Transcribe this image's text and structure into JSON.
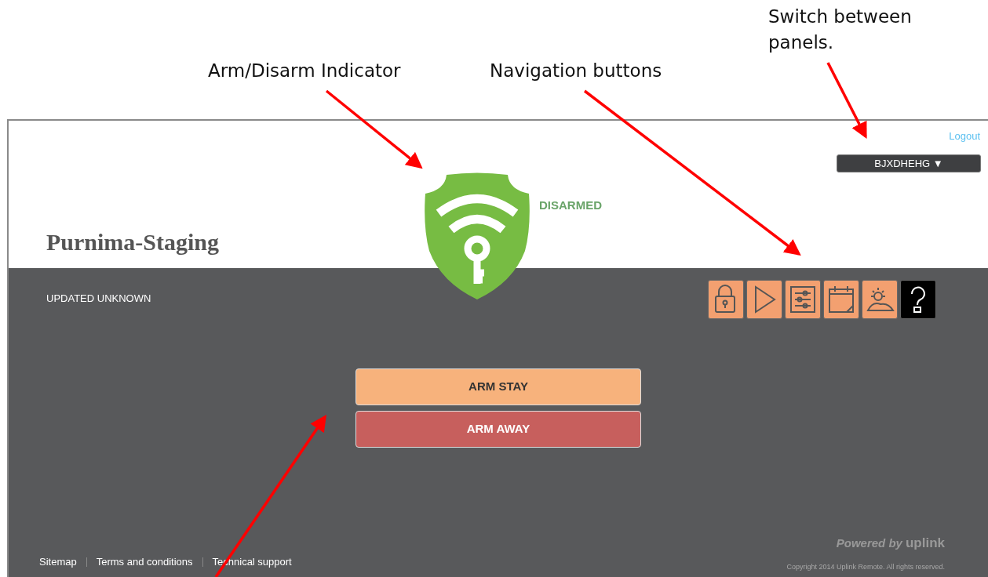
{
  "annotations": [
    {
      "text": "Arm/Disarm Indicator"
    },
    {
      "text": "Navigation buttons"
    },
    {
      "text": "Switch between panels."
    }
  ],
  "header": {
    "logout": "Logout",
    "panel_selector": "BJXDHEHG ▼",
    "site_title": "Purnima-Staging"
  },
  "status": {
    "label": "DISARMED",
    "armed": false
  },
  "updated": "UPDATED UNKNOWN",
  "nav_buttons": [
    {
      "selected": false
    },
    {
      "selected": false
    },
    {
      "selected": false
    },
    {
      "selected": false
    },
    {
      "selected": false
    },
    {
      "selected": true
    }
  ],
  "actions": [
    {
      "label": "ARM STAY",
      "kind": "stay"
    },
    {
      "label": "ARM AWAY",
      "kind": "away"
    }
  ],
  "footer": {
    "links": [
      "Sitemap",
      "Terms and conditions",
      "Technical support"
    ],
    "powered_by": "Powered by",
    "brand": "uplink",
    "copyright": "Copyright 2014 Uplink Remote. All rights reserved."
  }
}
